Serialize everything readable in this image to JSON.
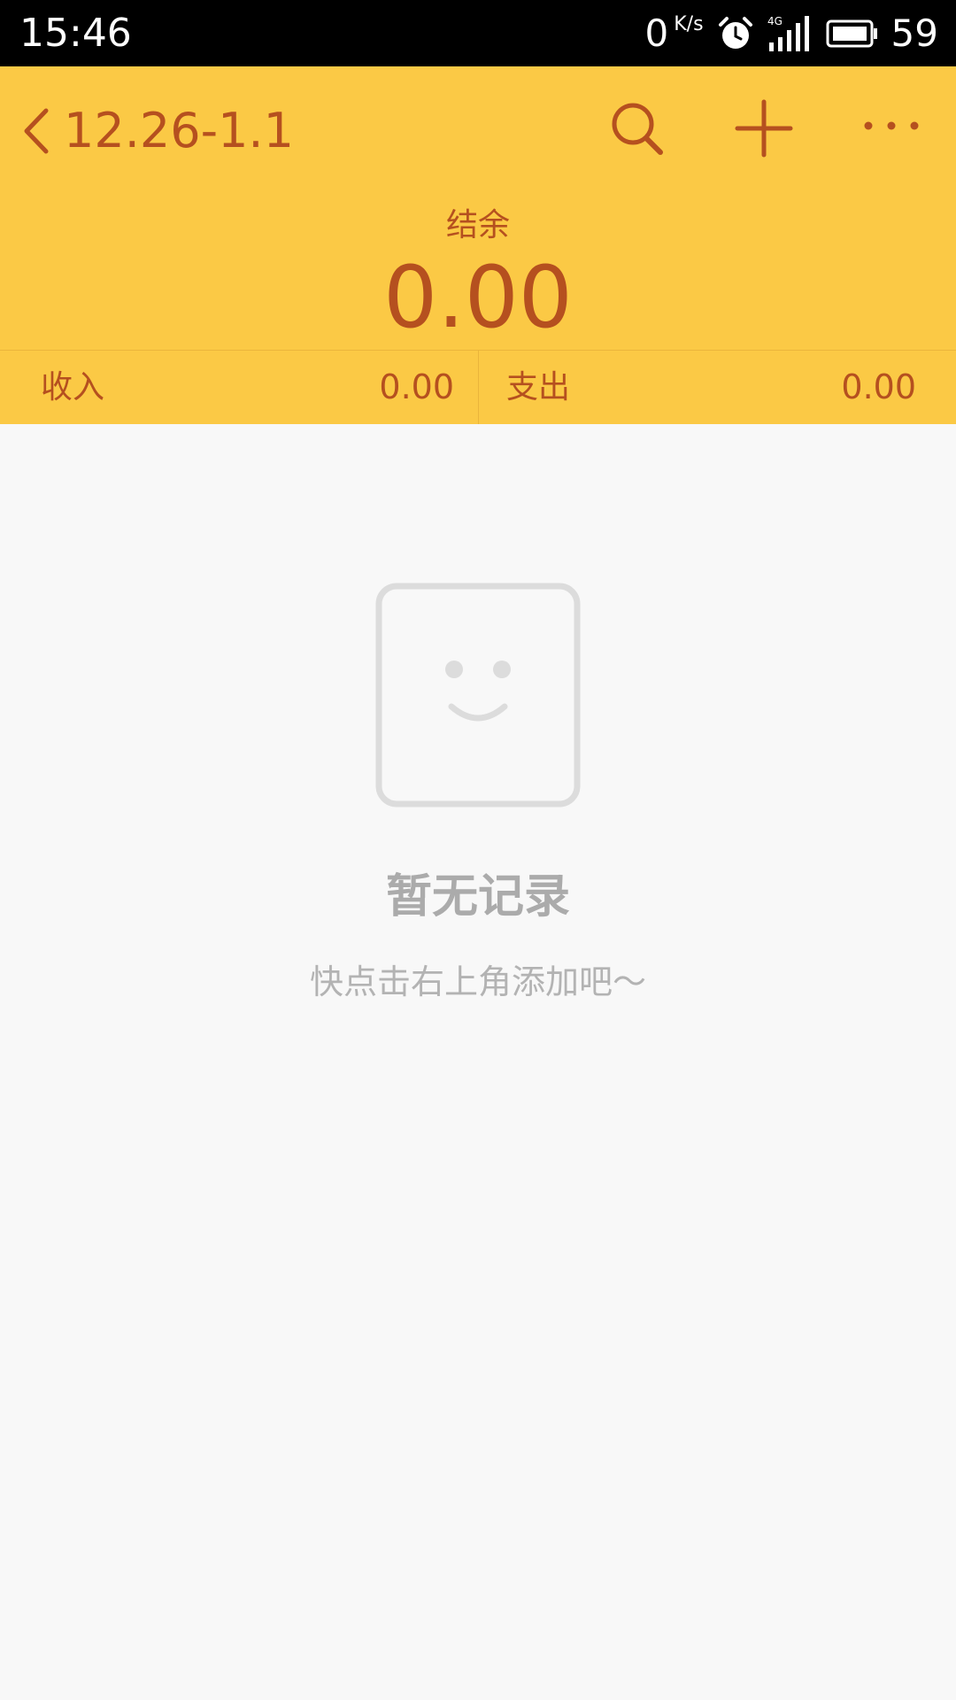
{
  "status_bar": {
    "time": "15:46",
    "net_speed": "0",
    "net_speed_unit": "K/s",
    "signal_label": "4G",
    "battery_level": "59"
  },
  "header": {
    "title": "12.26-1.1",
    "balance_label": "结余",
    "balance_value": "0.00",
    "income_label": "收入",
    "income_value": "0.00",
    "expense_label": "支出",
    "expense_value": "0.00",
    "icons": [
      "back-icon",
      "search-icon",
      "plus-icon",
      "more-icon"
    ]
  },
  "empty_state": {
    "title": "暂无记录",
    "subtitle": "快点击右上角添加吧～",
    "icon": "smiley-icon"
  },
  "colors": {
    "header_bg": "#fbc945",
    "accent_text": "#b5501f",
    "page_bg": "#f8f8f8",
    "muted_text": "#ababab"
  }
}
